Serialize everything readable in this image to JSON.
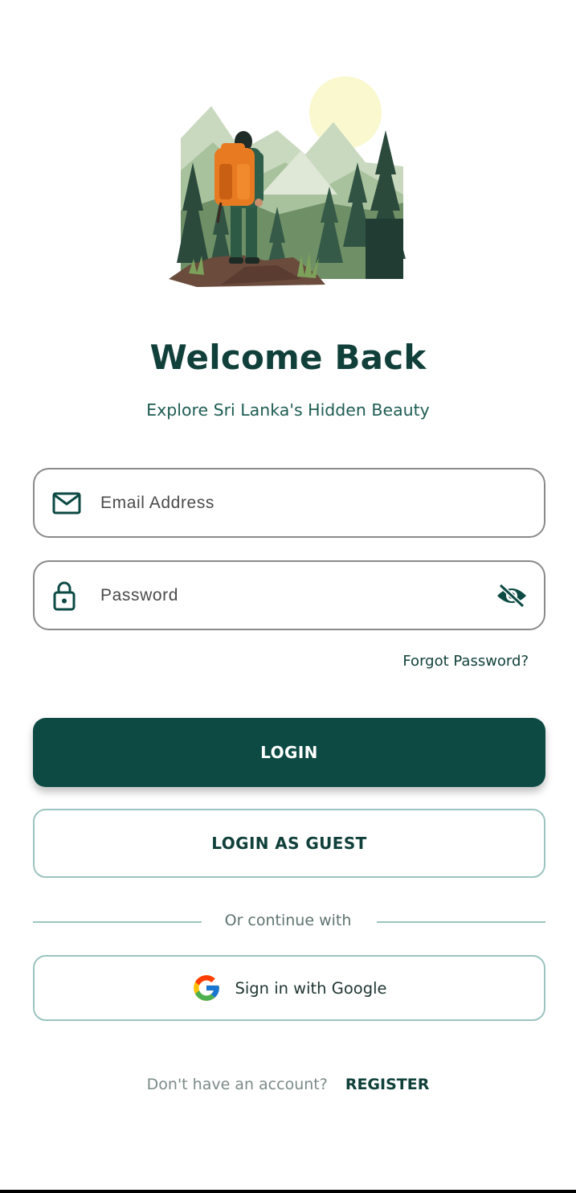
{
  "colors": {
    "brand_dark": "#0c4a43",
    "title": "#11403a",
    "subtitle": "#1e5c52",
    "outline": "#9cc4c0",
    "field_border": "#8a8a8a"
  },
  "hero": {
    "icon": "hiker-mountain-illustration"
  },
  "header": {
    "title": "Welcome Back",
    "subtitle": "Explore Sri Lanka's Hidden Beauty"
  },
  "form": {
    "email": {
      "label": "Email Address",
      "icon": "mail-icon"
    },
    "password": {
      "label": "Password",
      "icon": "lock-icon",
      "toggle_icon": "eye-off-icon"
    },
    "forgot_password": "Forgot Password?"
  },
  "actions": {
    "login": "LOGIN",
    "guest": "LOGIN AS GUEST"
  },
  "divider": {
    "text": "Or continue with"
  },
  "google": {
    "label": "Sign in with Google",
    "icon": "google-icon"
  },
  "footer": {
    "question": "Don't have an account?",
    "register": "REGISTER"
  }
}
